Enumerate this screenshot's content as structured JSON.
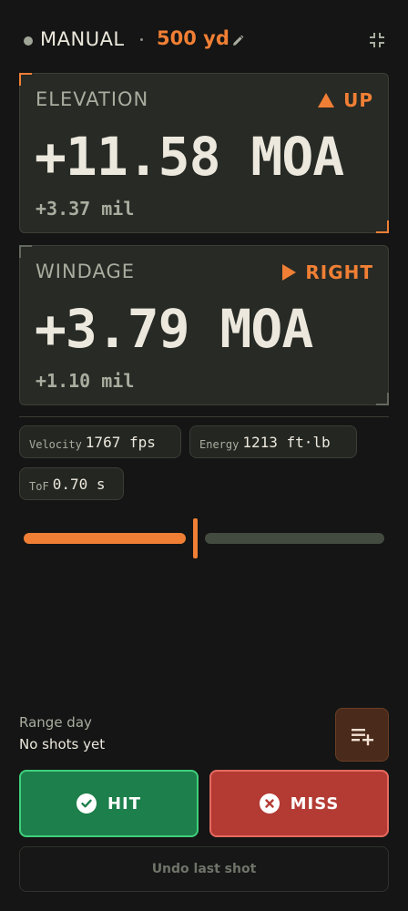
{
  "header": {
    "mode": "MANUAL",
    "range": "500 yd",
    "status_dot_color": "#9fa697",
    "icons": [
      "pencil-icon",
      "collapse-icon"
    ]
  },
  "elevation": {
    "label": "ELEVATION",
    "direction": "UP",
    "moa": "+11.58 MOA",
    "mil": "+3.37 mil"
  },
  "windage": {
    "label": "WINDAGE",
    "direction": "RIGHT",
    "moa": "+3.79 MOA",
    "mil": "+1.10 mil"
  },
  "stats": {
    "velocity": {
      "label": "Velocity",
      "value": "1767 fps"
    },
    "energy": {
      "label": "Energy",
      "value": "1213 ft·lb"
    },
    "tof": {
      "label": "ToF",
      "value": "0.70 s"
    }
  },
  "slider": {
    "level": 0.47
  },
  "session": {
    "title": "Range day",
    "status": "No shots yet"
  },
  "actions": {
    "hit": "HIT",
    "miss": "MISS",
    "undo": "Undo last shot"
  },
  "colors": {
    "accent": "#f07f35",
    "hit": "#1d7f4b",
    "miss": "#b33b34",
    "background": "#141514",
    "card": "#272a25"
  }
}
